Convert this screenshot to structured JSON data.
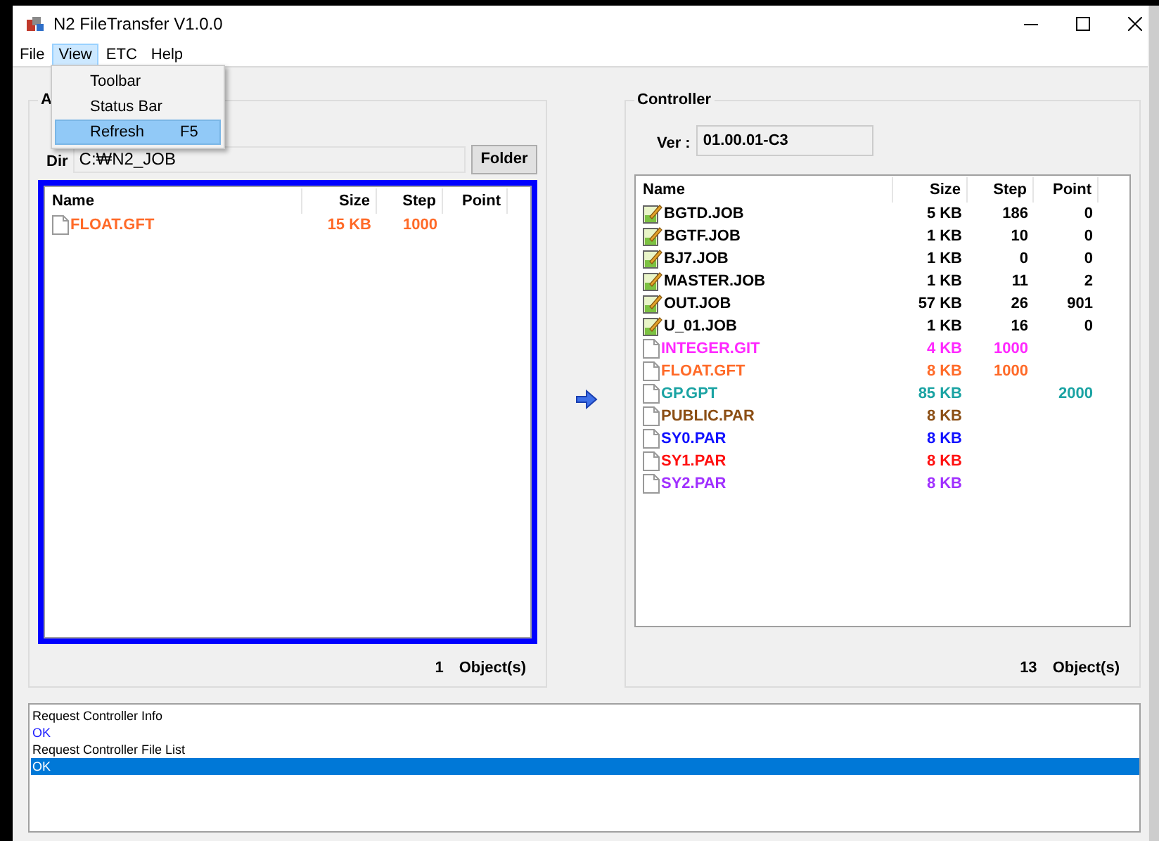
{
  "window": {
    "title": "N2 FileTransfer V1.0.0"
  },
  "menu": [
    {
      "label": "File",
      "selected": false
    },
    {
      "label": "View",
      "selected": true
    },
    {
      "label": "ETC",
      "selected": false
    },
    {
      "label": "Help",
      "selected": false
    }
  ],
  "open_menu": {
    "items": [
      {
        "label": "Toolbar",
        "selected": false
      },
      {
        "label": "Status Bar",
        "selected": false
      },
      {
        "label": "Refresh",
        "shortcut": "F5",
        "selected": true
      }
    ]
  },
  "local": {
    "group_title": "A",
    "dir_label": "Dir",
    "dir_value": "C:₩N2_JOB",
    "folder_button": "Folder",
    "focused": true,
    "columns": [
      "Name",
      "Size",
      "Step",
      "Point"
    ],
    "rows": [
      {
        "kind": "file",
        "name": "FLOAT.GFT",
        "size": "15 KB",
        "step": "1000",
        "point": "",
        "color": "#ff6a28"
      }
    ],
    "count": "1",
    "count_label": "Object(s)"
  },
  "transfer_button": {
    "kind": "arrow"
  },
  "controller": {
    "group_title": "Controller",
    "ver_label": "Ver :",
    "ver_value": "01.00.01-C3",
    "columns": [
      "Name",
      "Size",
      "Step",
      "Point"
    ],
    "rows": [
      {
        "kind": "job",
        "name": "BGTD.JOB",
        "size": "5 KB",
        "step": "186",
        "point": "0",
        "color": "#000000"
      },
      {
        "kind": "job",
        "name": "BGTF.JOB",
        "size": "1 KB",
        "step": "10",
        "point": "0",
        "color": "#000000"
      },
      {
        "kind": "job",
        "name": "BJ7.JOB",
        "size": "1 KB",
        "step": "0",
        "point": "0",
        "color": "#000000"
      },
      {
        "kind": "job",
        "name": "MASTER.JOB",
        "size": "1 KB",
        "step": "11",
        "point": "2",
        "color": "#000000"
      },
      {
        "kind": "job",
        "name": "OUT.JOB",
        "size": "57 KB",
        "step": "26",
        "point": "901",
        "color": "#000000"
      },
      {
        "kind": "job",
        "name": "U_01.JOB",
        "size": "1 KB",
        "step": "16",
        "point": "0",
        "color": "#000000"
      },
      {
        "kind": "file",
        "name": "INTEGER.GIT",
        "size": "4 KB",
        "step": "1000",
        "point": "",
        "color": "#ff28ff"
      },
      {
        "kind": "file",
        "name": "FLOAT.GFT",
        "size": "8 KB",
        "step": "1000",
        "point": "",
        "color": "#ff6a28"
      },
      {
        "kind": "file",
        "name": "GP.GPT",
        "size": "85 KB",
        "step": "",
        "point": "2000",
        "color": "#1aa3a3"
      },
      {
        "kind": "file",
        "name": "PUBLIC.PAR",
        "size": "8 KB",
        "step": "",
        "point": "",
        "color": "#8b4e14"
      },
      {
        "kind": "file",
        "name": "SY0.PAR",
        "size": "8 KB",
        "step": "",
        "point": "",
        "color": "#1010ff"
      },
      {
        "kind": "file",
        "name": "SY1.PAR",
        "size": "8 KB",
        "step": "",
        "point": "",
        "color": "#ff1010"
      },
      {
        "kind": "file",
        "name": "SY2.PAR",
        "size": "8 KB",
        "step": "",
        "point": "",
        "color": "#a030ff"
      }
    ],
    "count": "13",
    "count_label": "Object(s)"
  },
  "log": [
    {
      "kind": "message",
      "text": "Request Controller Info",
      "selected": false
    },
    {
      "kind": "result",
      "text": "OK",
      "selected": false
    },
    {
      "kind": "message",
      "text": "Request Controller File List",
      "selected": false
    },
    {
      "kind": "result",
      "text": "OK",
      "selected": true
    }
  ]
}
